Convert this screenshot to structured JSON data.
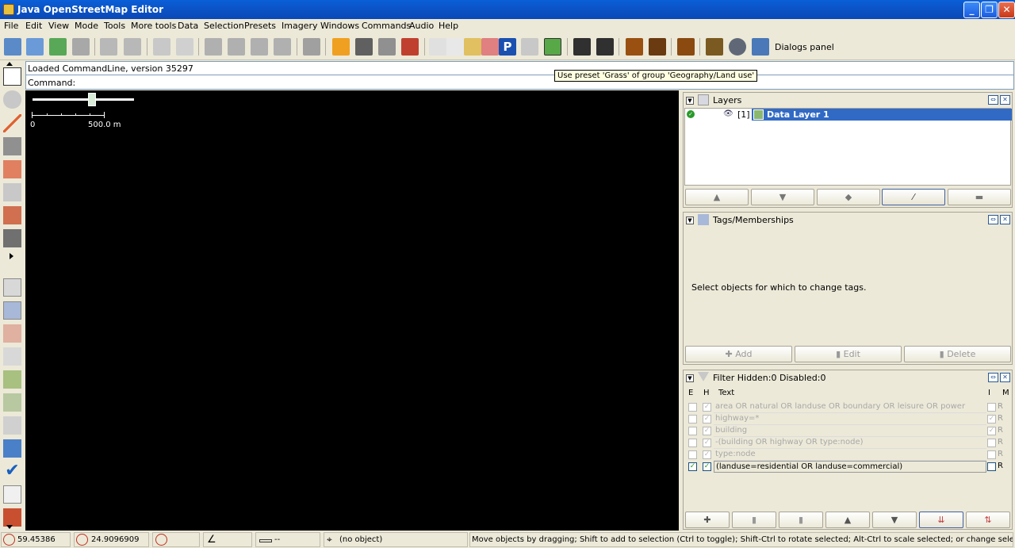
{
  "window": {
    "title": "Java OpenStreetMap Editor"
  },
  "menu": [
    "File",
    "Edit",
    "View",
    "Mode",
    "Tools",
    "More tools",
    "Data",
    "Selection",
    "Presets",
    "Imagery",
    "Windows",
    "Commands",
    "Audio",
    "Help"
  ],
  "toolbar": {
    "dialogs_panel_label": "Dialogs panel"
  },
  "command": {
    "log": "Loaded CommandLine, version 35297",
    "prompt": "Command:"
  },
  "tooltip": "Use preset 'Grass' of group 'Geography/Land use'",
  "map": {
    "scale_start": "0",
    "scale_end": "500.0 m"
  },
  "layers_panel": {
    "title": "Layers",
    "layers": [
      {
        "index": "[1]",
        "name": "Data Layer 1"
      }
    ]
  },
  "tags_panel": {
    "title": "Tags/Memberships",
    "empty_text": "Select objects for which to change tags.",
    "add_label": "Add",
    "edit_label": "Edit",
    "delete_label": "Delete"
  },
  "filter_panel": {
    "title": "Filter Hidden:0 Disabled:0",
    "columns": {
      "e": "E",
      "h": "H",
      "text": "Text",
      "i": "I",
      "m": "M"
    },
    "rows": [
      {
        "text": "area OR natural OR landuse OR boundary OR leisure OR power",
        "mode": "R"
      },
      {
        "text": "highway=*",
        "mode": "R"
      },
      {
        "text": "building",
        "mode": "R"
      },
      {
        "text": "-(building OR highway OR type:node)",
        "mode": "R"
      },
      {
        "text": "type:node",
        "mode": "R"
      },
      {
        "text": "(landuse=residential OR landuse=commercial)",
        "mode": "R"
      }
    ]
  },
  "status": {
    "lat": "59.45386",
    "lon": "24.9096909",
    "heading": "",
    "angle": "",
    "distance": "--",
    "object": "(no object)",
    "help": "Move objects by dragging; Shift to add to selection (Ctrl to toggle); Shift-Ctrl to rotate selected; Alt-Ctrl to scale selected; or change selection"
  }
}
